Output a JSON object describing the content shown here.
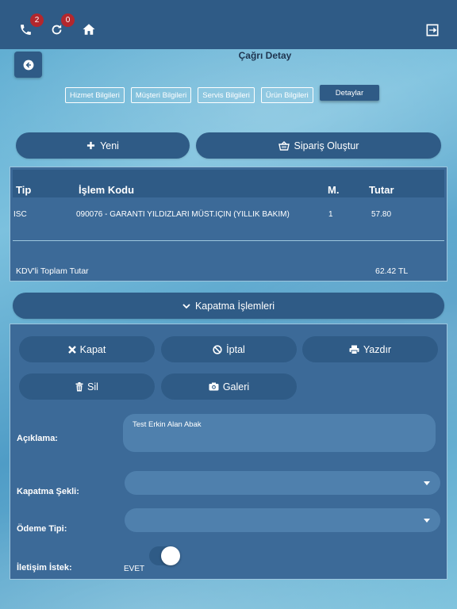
{
  "topbar": {
    "call_badge": "2",
    "refresh_badge": "0"
  },
  "page": {
    "title": "Çağrı Detay"
  },
  "tabs": [
    {
      "label": "Hizmet Bilgileri"
    },
    {
      "label": "Müşteri Bilgileri"
    },
    {
      "label": "Servis Bilgileri"
    },
    {
      "label": "Ürün Bilgileri"
    },
    {
      "label": "Detaylar"
    }
  ],
  "actions": {
    "new_label": "Yeni",
    "order_label": "Sipariş Oluştur"
  },
  "table": {
    "headers": [
      "Tip",
      "İşlem Kodu",
      "M.",
      "Tutar"
    ],
    "rows": [
      [
        "ISC",
        "090076 - GARANTI YILDIZLARI MÜST.IÇIN (YILLIK BAKIM)",
        "1",
        "57.80"
      ]
    ],
    "total_label": "KDV'li Toplam Tutar",
    "total_value": "62.42 TL"
  },
  "closing": {
    "section_label": "Kapatma İşlemleri",
    "close_label": "Kapat",
    "cancel_label": "İptal",
    "print_label": "Yazdır",
    "delete_label": "Sil",
    "gallery_label": "Galeri",
    "description_label": "Açıklama:",
    "description_value": "Test Erkin Alan Abak",
    "closing_type_label": "Kapatma Şekli:",
    "closing_type_value": "",
    "payment_type_label": "Ödeme Tipi:",
    "payment_type_value": "",
    "contact_request_label": "İletişim İstek:",
    "contact_request_value": "EVET"
  },
  "colors": {
    "bar": "#2f5b86",
    "panel": "#3c6a98",
    "badge": "#b3272d"
  }
}
